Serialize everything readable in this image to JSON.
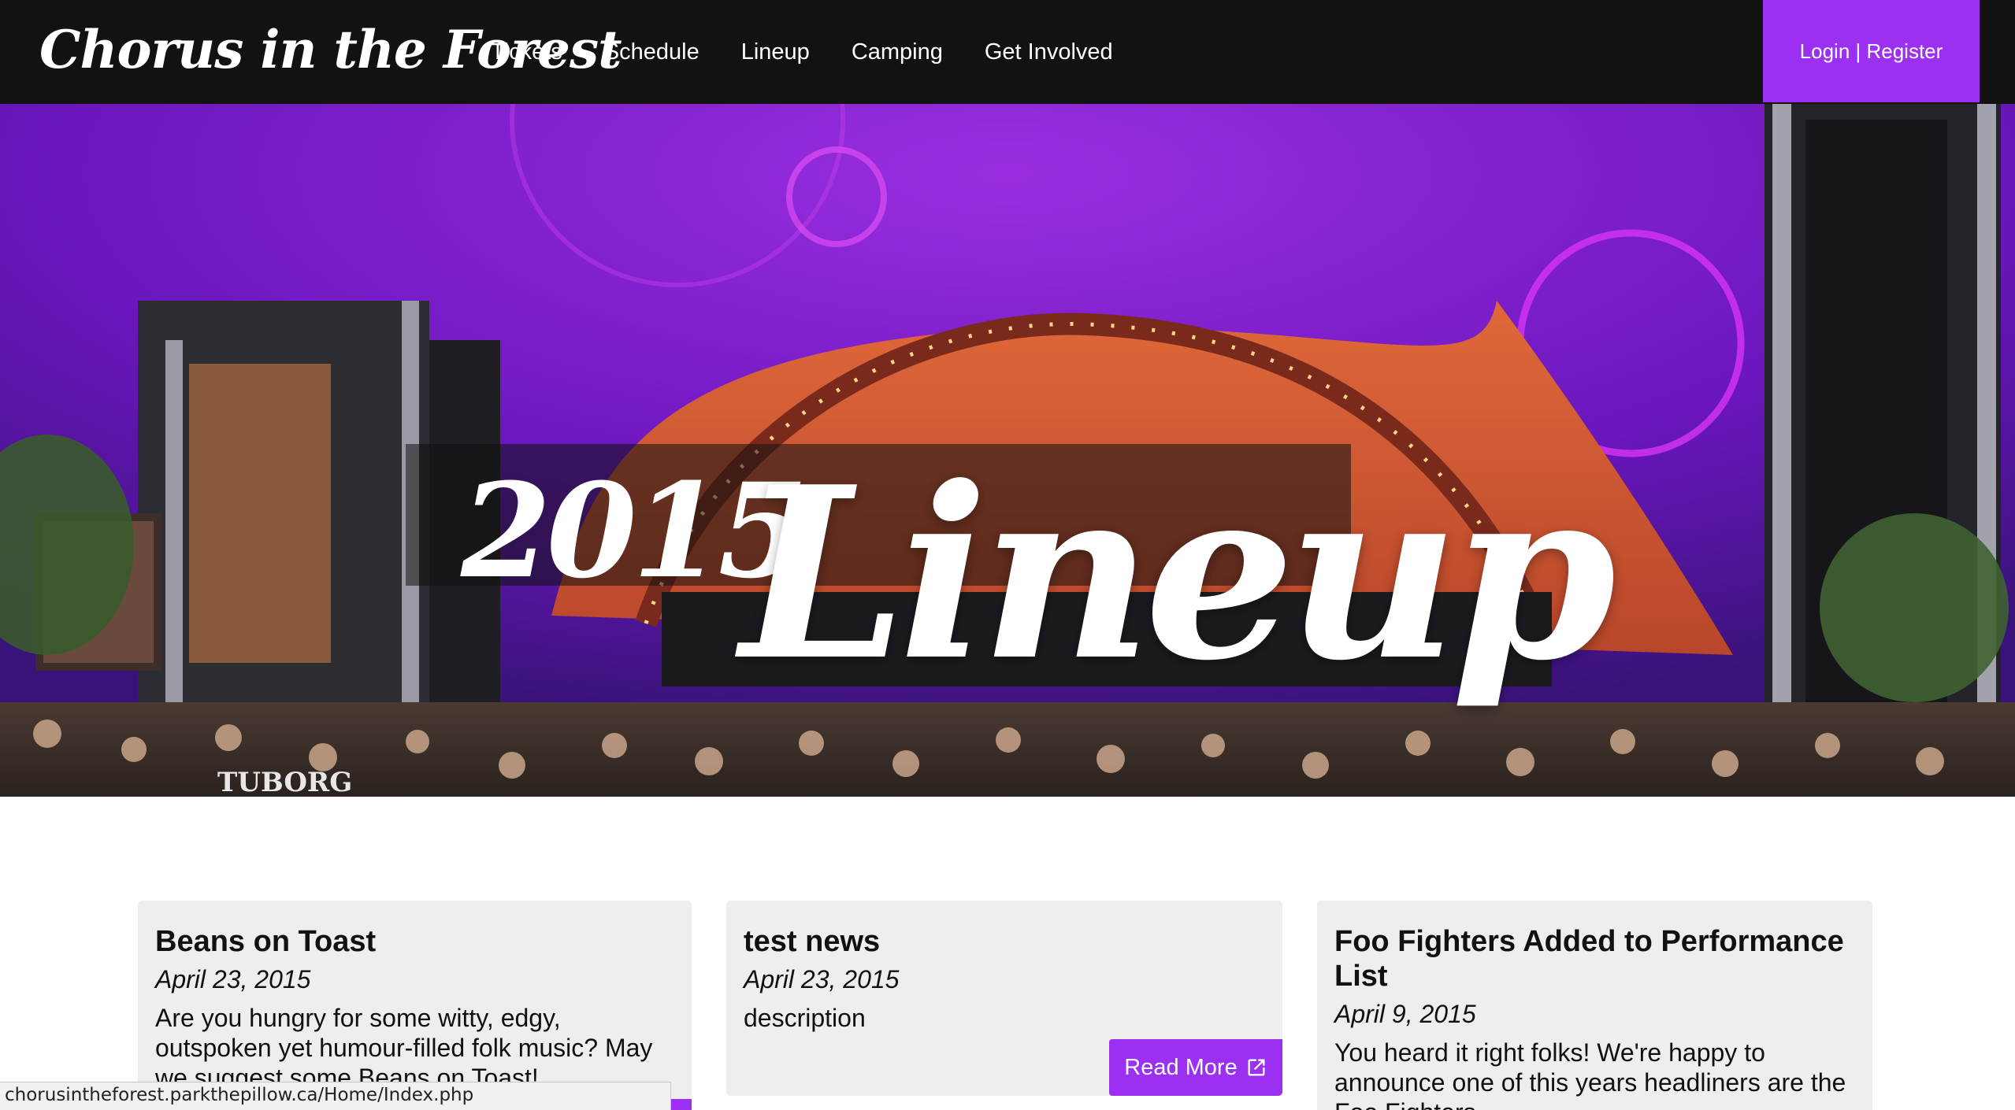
{
  "site": {
    "brand": "Chorus in the Forest"
  },
  "nav": {
    "items": [
      {
        "label": "Tickets"
      },
      {
        "label": "Schedule"
      },
      {
        "label": "Lineup"
      },
      {
        "label": "Camping"
      },
      {
        "label": "Get Involved"
      }
    ],
    "login_label": "Login | Register"
  },
  "hero": {
    "year": "2015",
    "word": "Lineup",
    "screen_sign": "TUBORG"
  },
  "news": [
    {
      "title": "Beans on Toast",
      "date": "April 23, 2015",
      "body": "Are you hungry for some witty, edgy, outspoken yet humour-filled folk music? May we suggest some Beans on Toast!"
    },
    {
      "title": "test news",
      "date": "April 23, 2015",
      "body": "description",
      "read_more_label": "Read More"
    },
    {
      "title": "Foo Fighters Added to Performance List",
      "date": "April 9, 2015",
      "body": "You heard it right folks! We're happy to announce one of this years headliners are the Foo Fighters"
    }
  ],
  "status_bar": {
    "url": "chorusintheforest.parkthepillow.ca/Home/Index.php"
  },
  "colors": {
    "accent": "#9b30f2",
    "nav_bg": "#121212",
    "card_bg": "#eeeeee"
  },
  "icons": {
    "read_more": "external-link-icon"
  }
}
